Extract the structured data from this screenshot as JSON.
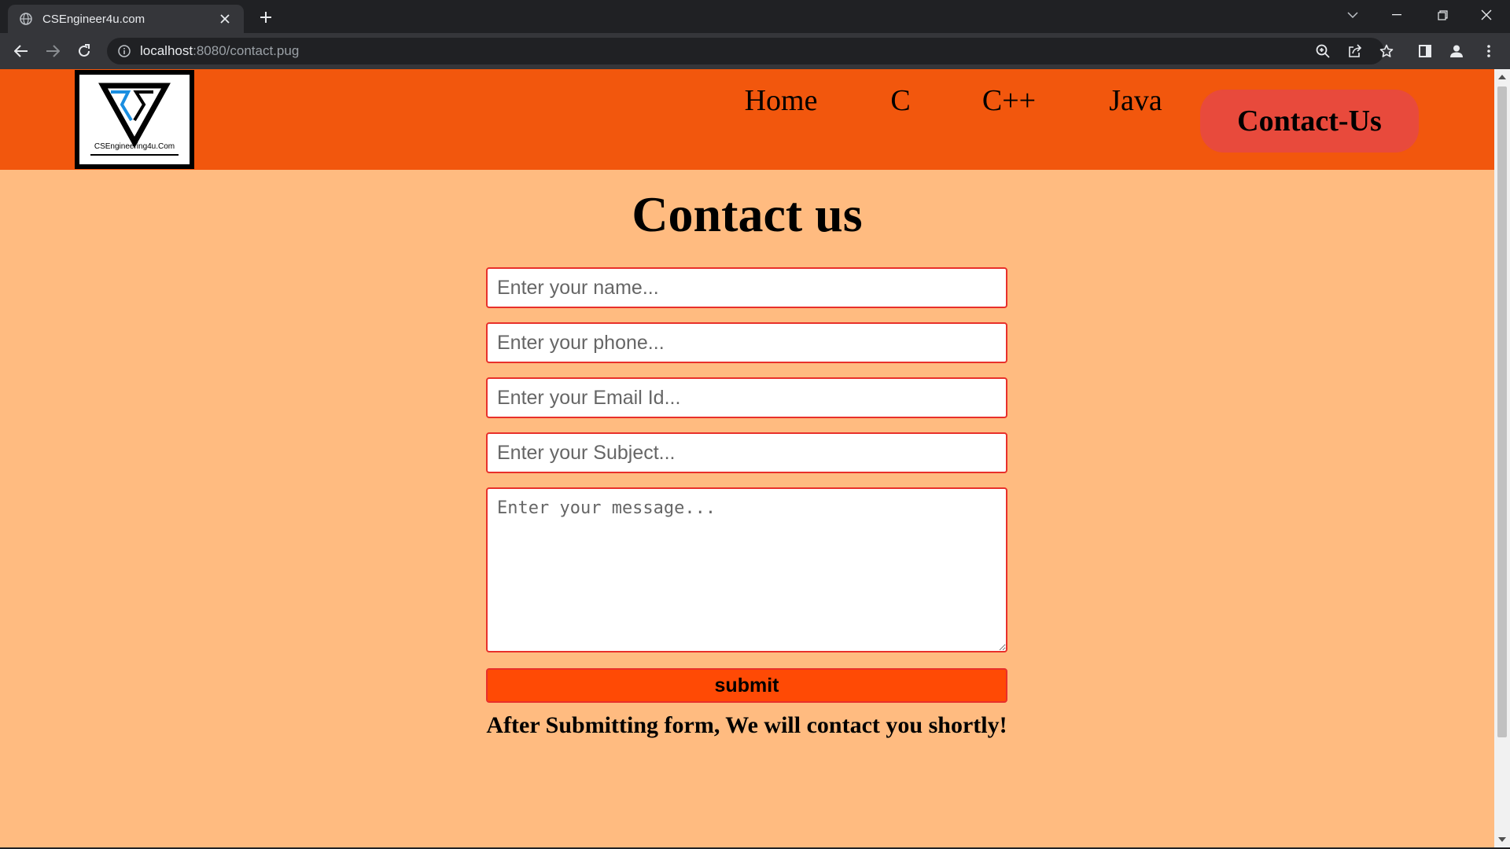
{
  "browser": {
    "tab_title": "CSEngineer4u.com",
    "url_host": "localhost",
    "url_path": ":8080/contact.pug"
  },
  "site": {
    "logo_text": "CSEngineering4u.Com",
    "nav": {
      "home": "Home",
      "c": "C",
      "cpp": "C++",
      "java": "Java",
      "contact": "Contact-Us"
    }
  },
  "page": {
    "title": "Contact us",
    "form": {
      "name_placeholder": "Enter your name...",
      "phone_placeholder": "Enter your phone...",
      "email_placeholder": "Enter your Email Id...",
      "subject_placeholder": "Enter your Subject...",
      "message_placeholder": "Enter your message...",
      "submit_label": "submit"
    },
    "note": "After Submitting form, We will contact you shortly!"
  },
  "colors": {
    "header": "#f2570d",
    "page_bg": "#ffbb80",
    "active_nav": "#e84a3c",
    "submit": "#ff4a05",
    "field_border": "#e8302b"
  },
  "icons": {
    "tab_favicon": "globe-icon",
    "tab_close": "close-icon",
    "new_tab": "plus-icon",
    "back": "arrow-left-icon",
    "forward": "arrow-right-icon",
    "reload": "reload-icon",
    "site_info": "info-icon",
    "zoom": "zoom-icon",
    "share": "share-icon",
    "bookmark": "star-icon",
    "side_panel": "side-panel-icon",
    "profile": "profile-icon",
    "menu": "kebab-menu-icon"
  }
}
